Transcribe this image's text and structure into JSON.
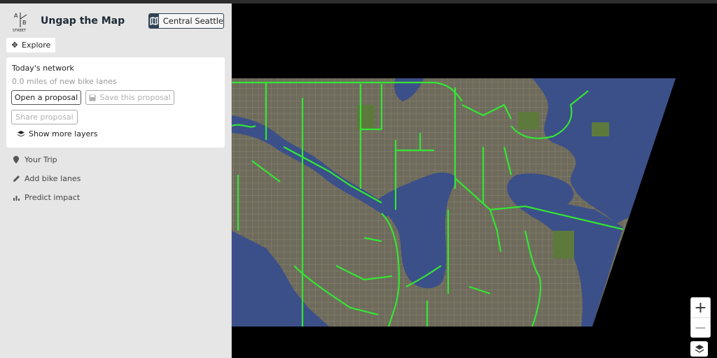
{
  "app": {
    "title": "Ungap the Map",
    "region_label": "Central Seattle",
    "logo": {
      "letters": [
        "A",
        "B"
      ],
      "caption": "STREET"
    }
  },
  "panel": {
    "explore_label": "Explore",
    "network": {
      "title": "Today's network",
      "miles_text": "0.0 miles of new bike lanes",
      "open_label": "Open a proposal",
      "save_label": "Save this proposal",
      "share_label": "Share proposal",
      "layers_label": "Show more layers"
    },
    "nav": [
      {
        "label": "Your Trip",
        "icon": "map-pin-icon"
      },
      {
        "label": "Add bike lanes",
        "icon": "pencil-icon"
      },
      {
        "label": "Predict impact",
        "icon": "bar-chart-icon"
      }
    ]
  },
  "map": {
    "colors": {
      "water": "#3b4f89",
      "land": "#6d6a5a",
      "park": "#5d7a3c",
      "bike_lane": "#33e633",
      "background": "#000000"
    }
  },
  "zoom": {
    "in_symbol": "+",
    "out_symbol": "−"
  }
}
